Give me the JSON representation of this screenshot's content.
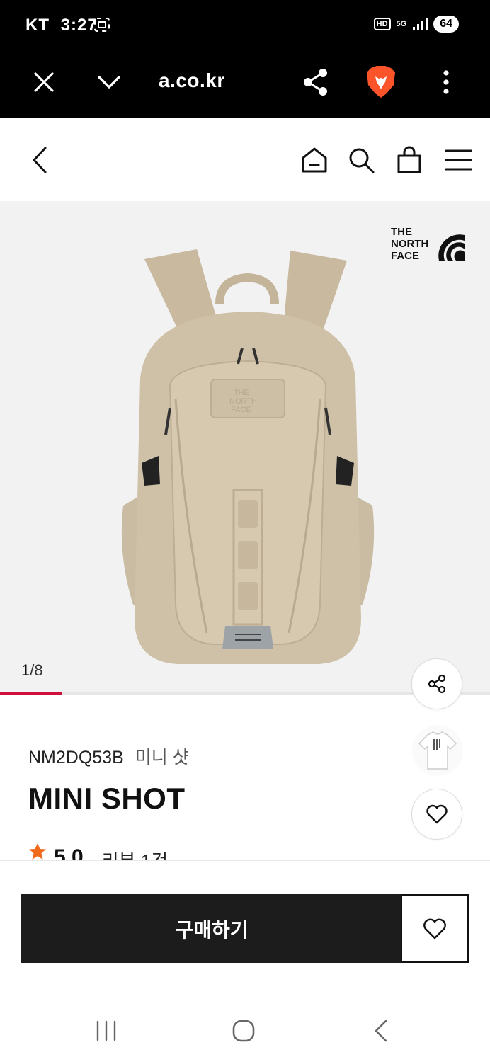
{
  "status_bar": {
    "carrier": "KT",
    "time": "3:27",
    "hd": "HD",
    "network": "5G",
    "battery": "64"
  },
  "browser": {
    "url": "a.co.kr",
    "icons": [
      "close-icon",
      "chevron-down-icon",
      "share-icon",
      "brave-lion-icon",
      "more-vertical-icon"
    ]
  },
  "header": {
    "icons": [
      "back-icon",
      "home-icon",
      "search-icon",
      "shopping-bag-icon",
      "menu-icon"
    ]
  },
  "gallery": {
    "brand_logo_lines": [
      "THE",
      "NORTH",
      "FACE"
    ],
    "current": "1",
    "total": "/8",
    "progress_fraction": 0.125,
    "accent_color": "#d0103a"
  },
  "product": {
    "code": "NM2DQ53B",
    "korean_name": "미니 샷",
    "name": "MINI SHOT",
    "rating": "5.0",
    "reviews": "리뷰 1건"
  },
  "actions": {
    "buy_label": "구매하기"
  },
  "colors": {
    "buy_button": "#1c1c1c",
    "star": "#f06a1b",
    "bag": "#cdbfa5"
  }
}
